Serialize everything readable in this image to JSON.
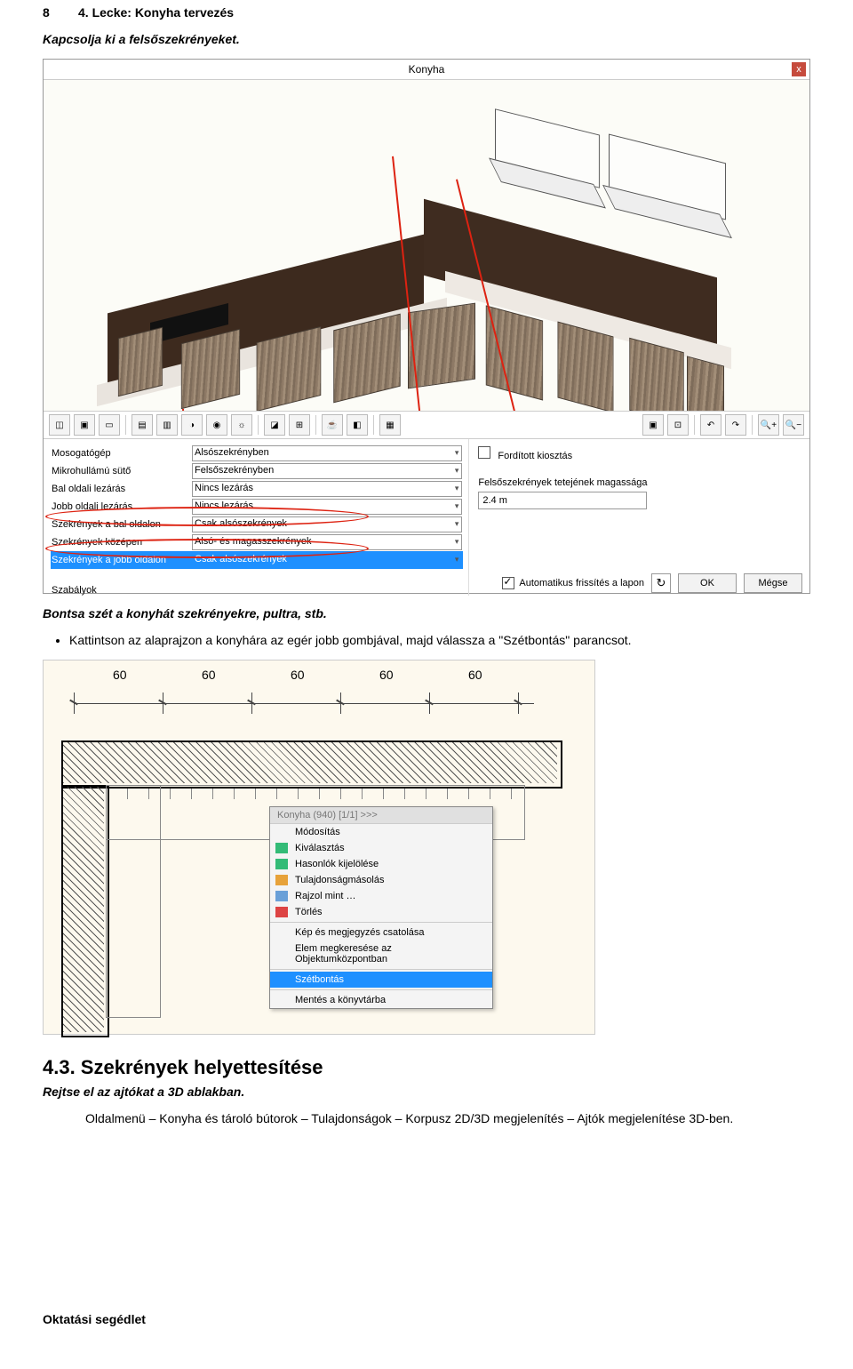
{
  "header": {
    "page_number": "8",
    "title": "4. Lecke: Konyha tervezés"
  },
  "p1": "Kapcsolja ki a felsőszekrényeket.",
  "dialog": {
    "title": "Konyha",
    "close_icon": "x",
    "toolbar": [
      "◫",
      "▣",
      "▭",
      "▤",
      "▥",
      "◑",
      "◉",
      "☼",
      "◪",
      "⊞",
      "☕",
      "◧",
      "▦"
    ],
    "toolbar_right": [
      "▣",
      "⊡",
      "↶",
      "↷",
      "🔍+",
      "🔍−"
    ],
    "checkbox_forditott": "Fordított kiosztás",
    "height_label": "Felsőszekrények tetejének magassága",
    "height_value": "2.4 m",
    "rows": [
      {
        "label": "Mosogatógép",
        "value": "Alsószekrényben"
      },
      {
        "label": "Mikrohullámú sütő",
        "value": "Felsőszekrényben"
      },
      {
        "label": "Bal oldali lezárás",
        "value": "Nincs lezárás"
      },
      {
        "label": "Jobb oldali lezárás",
        "value": "Nincs lezárás"
      },
      {
        "label": "Szekrények a bal oldalon",
        "value": "Csak alsószekrények"
      },
      {
        "label": "Szekrények középen",
        "value": "Alsó- és magasszekrények"
      },
      {
        "label": "Szekrények a jobb oldalon",
        "value": "Csak alsószekrények"
      }
    ],
    "rules_label": "Szabályok",
    "auto_refresh": "Automatikus frissítés a lapon",
    "refresh_icon": "↻",
    "ok": "OK",
    "cancel": "Mégse"
  },
  "p2": "Bontsa szét a konyhát szekrényekre, pultra, stb.",
  "bullet1": "Kattintson az alaprajzon a konyhára az egér jobb gombjával, majd válassza a \"Szétbontás\" parancsot.",
  "plan": {
    "dims": [
      "60",
      "60",
      "60",
      "60",
      "60"
    ],
    "popup_header": "Konyha (940) [1/1] >>>",
    "popup_items": [
      "Módosítás",
      "Kiválasztás",
      "Hasonlók kijelölése",
      "Tulajdonságmásolás",
      "Rajzol mint …",
      "Törlés",
      "Kép és megjegyzés csatolása",
      "Elem megkeresése az Objektumközpontban",
      "Szétbontás",
      "Mentés a könyvtárba"
    ],
    "highlight_index": 8
  },
  "section_heading": "4.3.  Szekrények helyettesítése",
  "p3": "Rejtse el az ajtókat a 3D ablakban.",
  "p4": "Oldalmenü – Konyha és tároló bútorok – Tulajdonságok – Korpusz 2D/3D megjelenítés – Ajtók megjelenítése 3D-ben.",
  "footer": "Oktatási segédlet"
}
